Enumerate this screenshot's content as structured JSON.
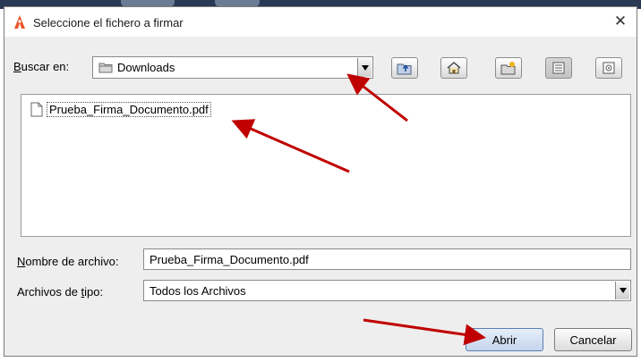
{
  "dialog": {
    "title": "Seleccione el fichero a firmar",
    "close_glyph": "✕"
  },
  "look_in": {
    "label_underlined": "B",
    "label_rest": "uscar en:",
    "value": "Downloads"
  },
  "toolbar": [
    {
      "name": "up-folder-icon"
    },
    {
      "name": "home-icon"
    },
    {
      "name": "new-folder-icon"
    },
    {
      "name": "list-view-icon"
    },
    {
      "name": "details-view-icon"
    }
  ],
  "files": [
    {
      "name": "Prueba_Firma_Documento.pdf",
      "icon": "file-icon"
    }
  ],
  "file_name": {
    "label_underlined": "N",
    "label_rest": "ombre de archivo:",
    "value": "Prueba_Firma_Documento.pdf"
  },
  "file_type": {
    "label_before": "Archivos de ",
    "label_underlined": "t",
    "label_after": "ipo:",
    "value": "Todos los Archivos"
  },
  "buttons": {
    "open": "Abrir",
    "cancel": "Cancelar"
  },
  "colors": {
    "annotation_arrow": "#c00000",
    "app_icon": "#e8562a",
    "folder": "#8a8a8a"
  }
}
